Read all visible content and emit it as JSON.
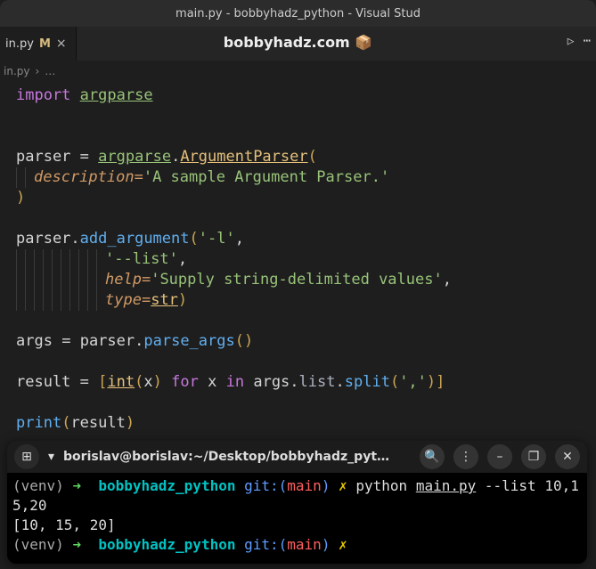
{
  "titlebar": {
    "text": "main.py - bobbyhadz_python - Visual Stud"
  },
  "tab": {
    "label": "in.py",
    "modified": "M",
    "close": "×"
  },
  "center": {
    "label": "bobbyhadz.com 📦"
  },
  "toolbar": {
    "run": "▷",
    "menu": "⋯"
  },
  "breadcrumb": {
    "file": "in.py",
    "sep": "›",
    "dots": "…"
  },
  "code": {
    "l1": {
      "import": "import",
      "sp": " ",
      "mod": "argparse"
    },
    "l4": {
      "ident": "parser",
      "eq": "=",
      "mod": "argparse",
      "dot": ".",
      "cls": "ArgumentParser",
      "open": "("
    },
    "l5": {
      "param": "description",
      "eq": "=",
      "str": "'A sample Argument Parser.'"
    },
    "l6": {
      "close": ")"
    },
    "l8": {
      "ident": "parser",
      "dot": ".",
      "fn": "add_argument",
      "open": "(",
      "arg1": "'-l'",
      "comma": ","
    },
    "l9": {
      "arg2": "'--list'",
      "comma": ","
    },
    "l10": {
      "param": "help",
      "eq": "=",
      "str": "'Supply string-delimited values'",
      "comma": ","
    },
    "l11": {
      "param": "type",
      "eq": "=",
      "type": "str",
      "close": ")"
    },
    "l13": {
      "ident": "args",
      "eq": "=",
      "p": "parser",
      "dot": ".",
      "fn": "parse_args",
      "open": "(",
      "close": ")"
    },
    "l15": {
      "ident": "result",
      "eq": "=",
      "lb": "[",
      "type": "int",
      "open": "(",
      "x1": "x",
      "close": ")",
      "for": "for",
      "x2": "x",
      "in": "in",
      "args": "args",
      "dot1": ".",
      "list": "list",
      "dot2": ".",
      "split": "split",
      "open2": "(",
      "comma_str": "','",
      "close2": ")",
      "rb": "]"
    },
    "l17": {
      "fn": "print",
      "open": "(",
      "arg": "result",
      "close": ")"
    }
  },
  "terminal": {
    "title": "borislav@borislav:~/Desktop/bobbyhadz_pyt…",
    "icons": {
      "newtab": "⊞",
      "chev": "▾",
      "search": "🔍",
      "menu": "⋮",
      "min": "–",
      "max": "❐",
      "close": "✕"
    },
    "line1": {
      "venv": "(venv)",
      "arrow": "➜",
      "dir": "bobbyhadz_python",
      "git": "git:(",
      "branch": "main",
      "gitclose": ")",
      "flash": "✗",
      "cmd_python": "python",
      "cmd_file": "main.py",
      "cmd_args": " --list 10,15,20"
    },
    "line2": {
      "out": "[10, 15, 20]"
    },
    "line3": {
      "venv": "(venv)",
      "arrow": "➜",
      "dir": "bobbyhadz_python",
      "git": "git:(",
      "branch": "main",
      "gitclose": ")",
      "flash": "✗"
    }
  }
}
